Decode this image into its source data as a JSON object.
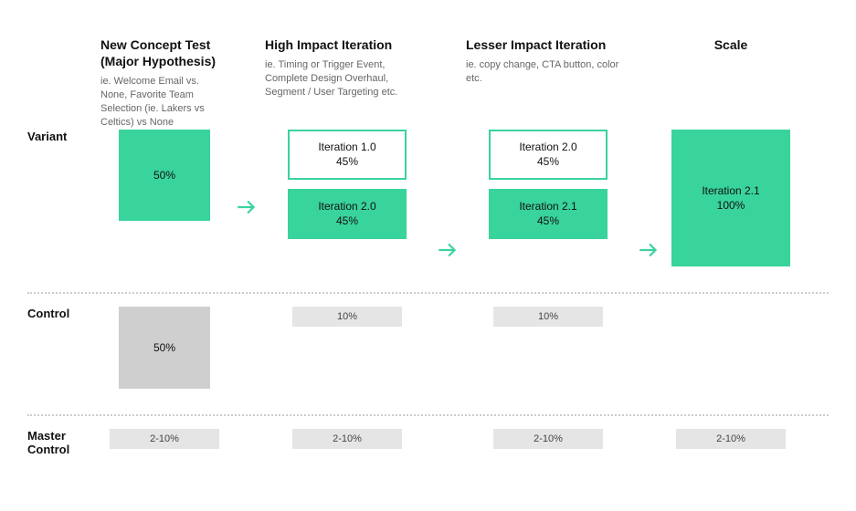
{
  "columns": {
    "c1": {
      "title": "New Concept Test\n(Major Hypothesis)",
      "sub": "ie. Welcome Email vs. None, Favorite Team Selection (ie. Lakers vs Celtics) vs None"
    },
    "c2": {
      "title": "High Impact Iteration",
      "sub": "ie. Timing or Trigger Event, Complete Design Overhaul, Segment / User Targeting etc."
    },
    "c3": {
      "title": "Lesser Impact Iteration",
      "sub": "ie. copy change, CTA button, color etc."
    },
    "c4": {
      "title": "Scale",
      "sub": ""
    }
  },
  "rows": {
    "variant": "Variant",
    "control": "Control",
    "master": "Master Control"
  },
  "variant": {
    "c1": {
      "pct": "50%"
    },
    "c2": {
      "top": {
        "name": "Iteration 1.0",
        "pct": "45%"
      },
      "bottom": {
        "name": "Iteration 2.0",
        "pct": "45%"
      }
    },
    "c3": {
      "top": {
        "name": "Iteration 2.0",
        "pct": "45%"
      },
      "bottom": {
        "name": "Iteration 2.1",
        "pct": "45%"
      }
    },
    "c4": {
      "name": "Iteration 2.1",
      "pct": "100%"
    }
  },
  "control": {
    "c1": {
      "pct": "50%"
    },
    "c2": {
      "pct": "10%"
    },
    "c3": {
      "pct": "10%"
    }
  },
  "master": {
    "c1": "2-10%",
    "c2": "2-10%",
    "c3": "2-10%",
    "c4": "2-10%"
  }
}
